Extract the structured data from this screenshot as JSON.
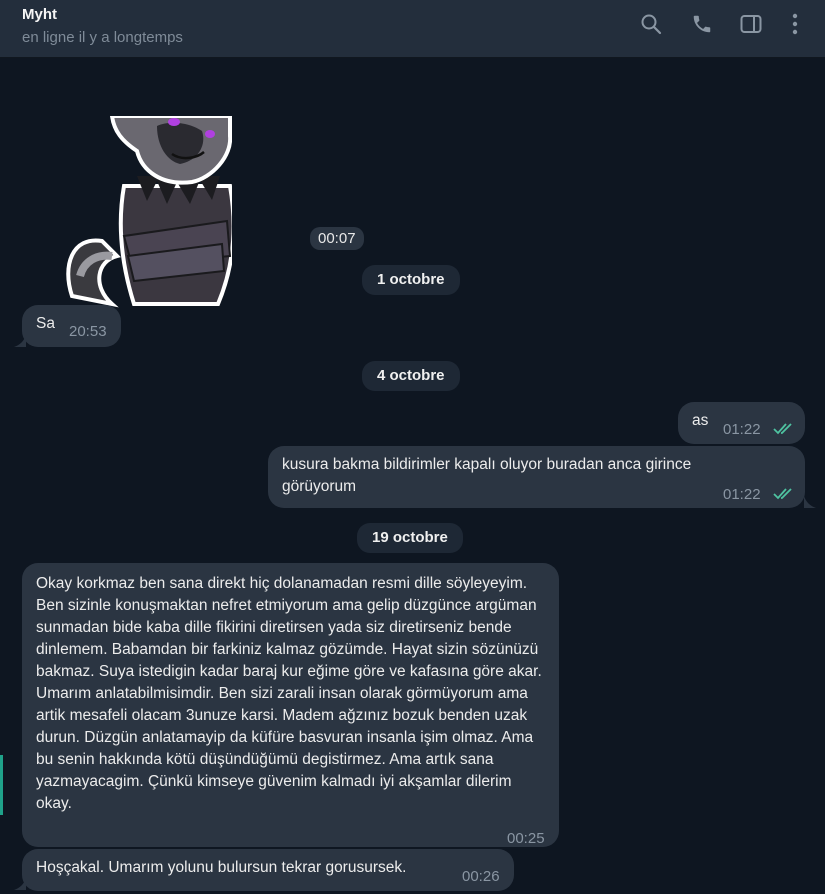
{
  "header": {
    "name": "Myht",
    "status": "en ligne il y a longtemps",
    "icons": [
      "search-icon",
      "phone-icon",
      "sidebar-toggle-icon",
      "more-vertical-icon"
    ]
  },
  "colors": {
    "background": "#0e1621",
    "header": "#232e3c",
    "bubble": "#2b3542",
    "read_check": "#4fc3a1",
    "accent": "#1fa28a"
  },
  "messages": {
    "sticker_time": "00:07",
    "date1": "1 octobre",
    "m1_text": "Sa",
    "m1_time": "20:53",
    "date2": "4 octobre",
    "m2_text": "as",
    "m2_time": "01:22",
    "m3_text": "kusura bakma bildirimler kapalı oluyor buradan anca girince görüyorum",
    "m3_time": "01:22",
    "date3": "19 octobre",
    "m4_text": "Okay korkmaz ben sana direkt hiç dolanamadan resmi dille söyleyeyim. Ben sizinle konuşmaktan nefret etmiyorum ama gelip düzgünce argüman sunmadan bide kaba dille fikirini diretirsen yada siz diretirseniz bende dinlemem. Babamdan bir farkiniz kalmaz gözümde. Hayat sizin sözünüzü bakmaz. Suya istedigin kadar baraj kur eğime göre ve kafasına göre akar. Umarım anlatabilmisimdir. Ben sizi zarali insan olarak görmüyorum ama artik mesafeli olacam 3unuze karsi. Madem ağzınız bozuk benden uzak durun. Düzgün anlatamayip da küfüre basvuran insanla işim olmaz. Ama bu senin hakkında kötü düşündüğümü degistirmez. Ama artık sana yazmayacagim. Çünkü kimseye güvenim kalmadı iyi akşamlar dilerim okay.",
    "m4_time": "00:25",
    "m5_text": "Hoşçakal. Umarım yolunu bulursun tekrar gorusursek.",
    "m5_time": "00:26"
  }
}
